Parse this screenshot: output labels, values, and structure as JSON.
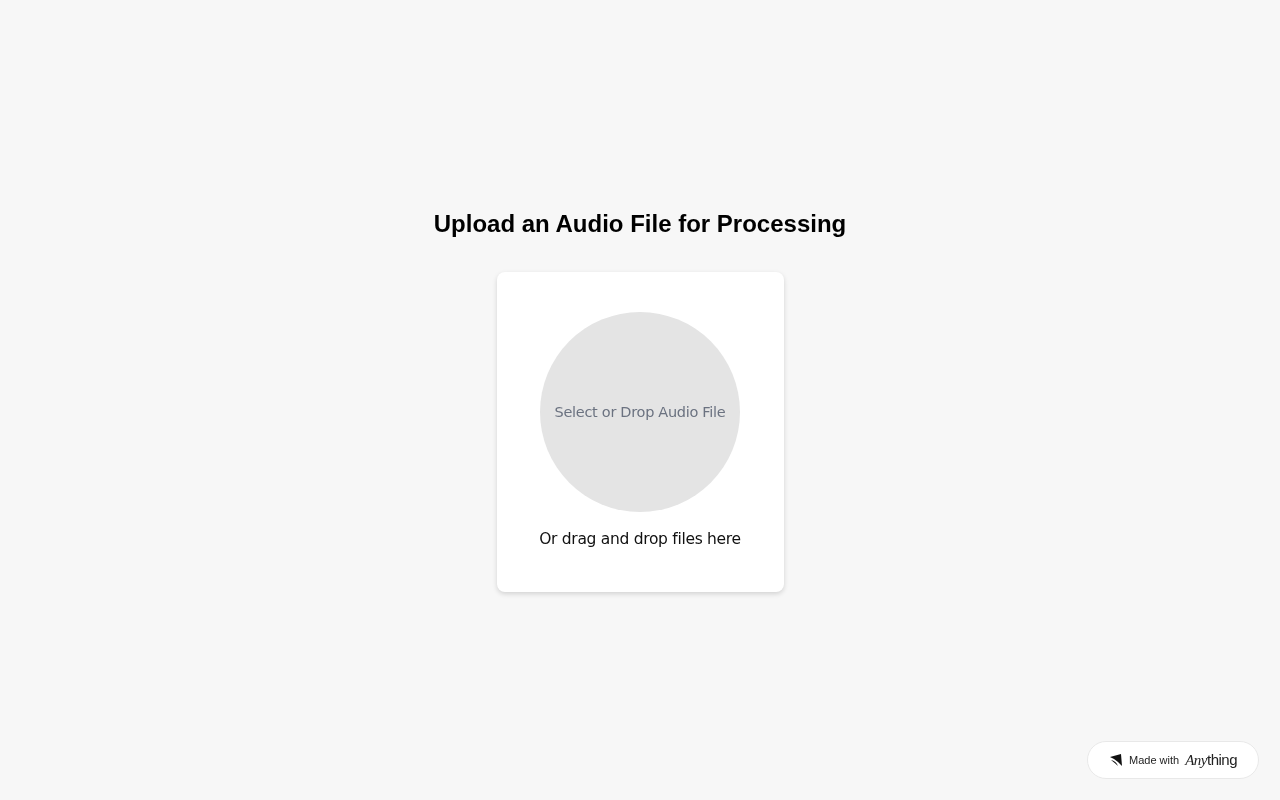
{
  "title": "Upload an Audio File for Processing",
  "upload": {
    "button": "Select or Drop Audio File",
    "hint": "Or drag and drop files here"
  },
  "badge": {
    "label": "Made with",
    "brand": {
      "italic": "Any",
      "plain": "thing"
    }
  }
}
